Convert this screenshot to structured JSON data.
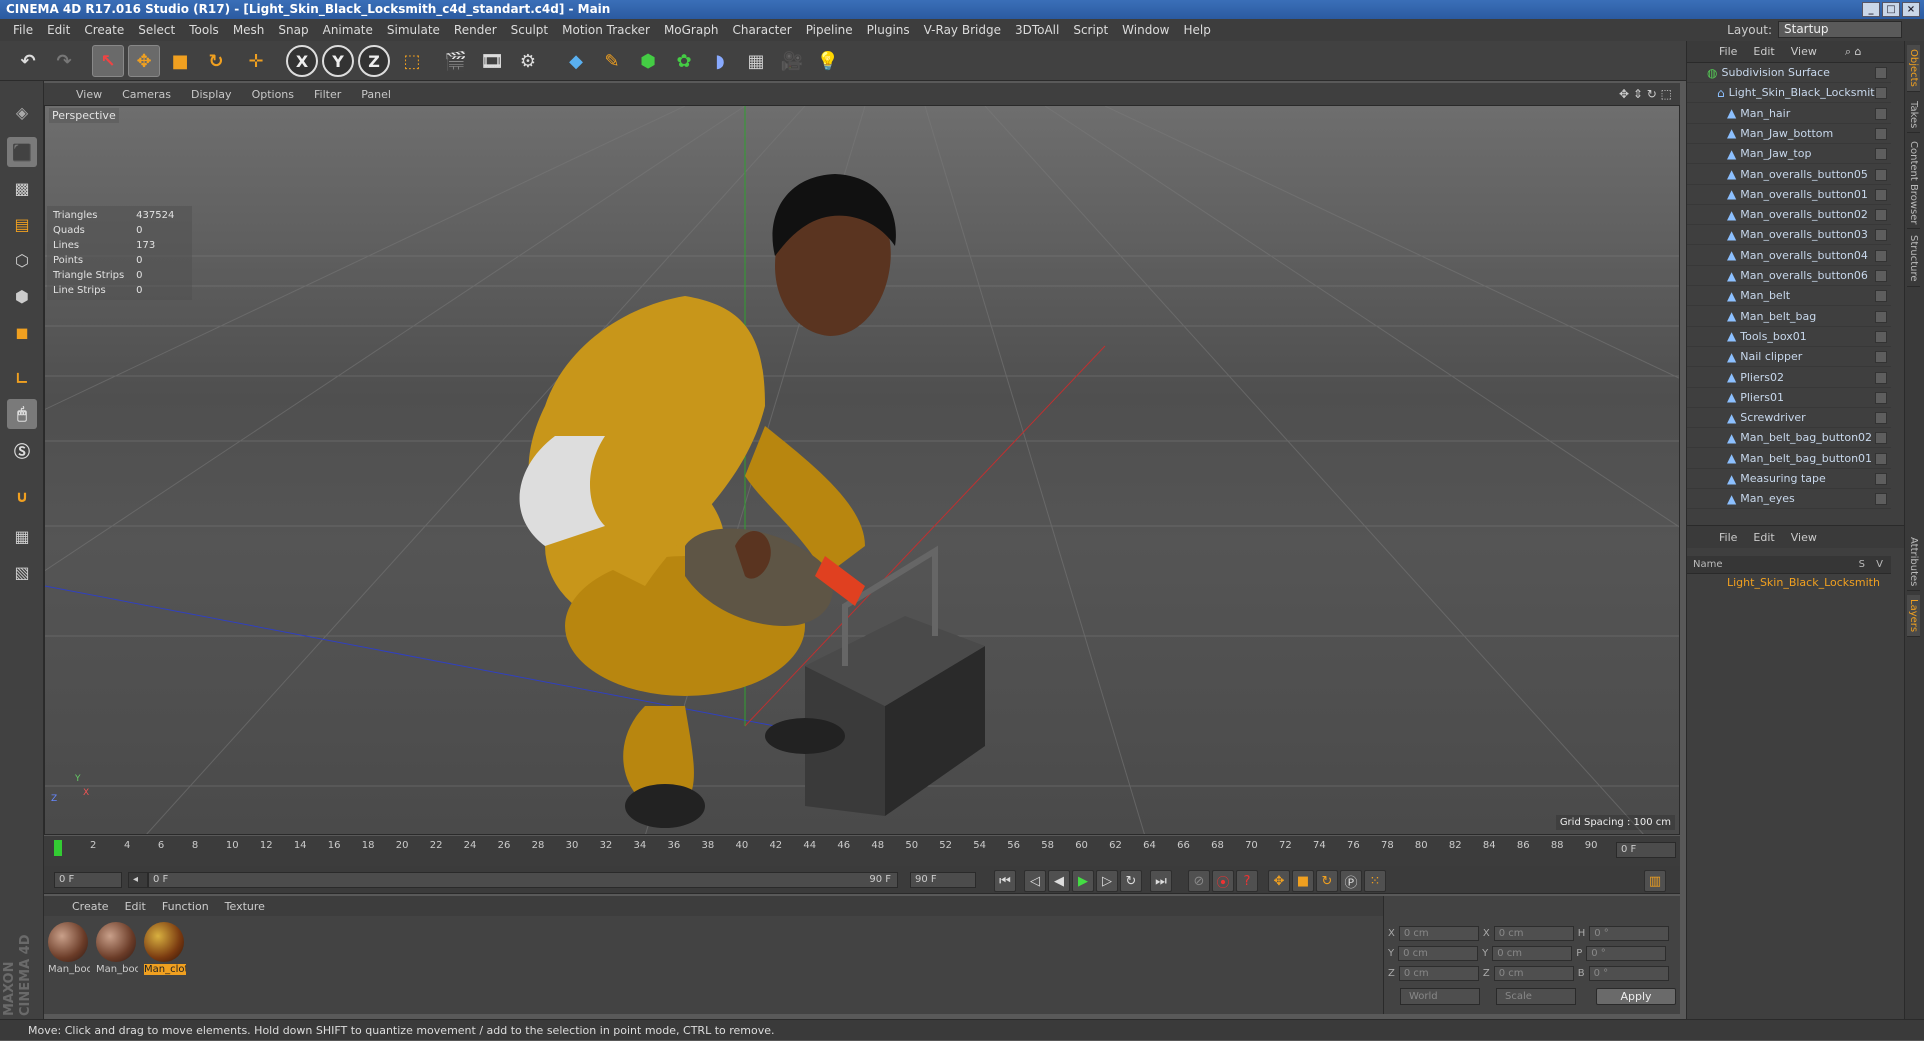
{
  "window": {
    "title": "CINEMA 4D R17.016 Studio (R17) - [Light_Skin_Black_Locksmith_c4d_standart.c4d] - Main"
  },
  "menu": [
    "File",
    "Edit",
    "Create",
    "Select",
    "Tools",
    "Mesh",
    "Snap",
    "Animate",
    "Simulate",
    "Render",
    "Sculpt",
    "Motion Tracker",
    "MoGraph",
    "Character",
    "Pipeline",
    "Plugins",
    "V-Ray Bridge",
    "3DToAll",
    "Script",
    "Window",
    "Help"
  ],
  "layout": {
    "label": "Layout:",
    "value": "Startup"
  },
  "toolbar": {
    "x": "X",
    "y": "Y",
    "z": "Z"
  },
  "viewport": {
    "menu": [
      "View",
      "Cameras",
      "Display",
      "Options",
      "Filter",
      "Panel"
    ],
    "label": "Perspective",
    "stats": [
      {
        "k": "Triangles",
        "v": "437524"
      },
      {
        "k": "Quads",
        "v": "0"
      },
      {
        "k": "Lines",
        "v": "173"
      },
      {
        "k": "Points",
        "v": "0"
      },
      {
        "k": "Triangle Strips",
        "v": "0"
      },
      {
        "k": "Line Strips",
        "v": "0"
      }
    ],
    "grid_spacing": "Grid Spacing : 100 cm",
    "axis_y": "Y",
    "axis_z": "Z",
    "axis_x": "X"
  },
  "timeline": {
    "ticks": [
      "0",
      "2",
      "4",
      "6",
      "8",
      "10",
      "12",
      "14",
      "16",
      "18",
      "20",
      "22",
      "24",
      "26",
      "28",
      "30",
      "32",
      "34",
      "36",
      "38",
      "40",
      "42",
      "44",
      "46",
      "48",
      "50",
      "52",
      "54",
      "56",
      "58",
      "60",
      "62",
      "64",
      "66",
      "68",
      "70",
      "72",
      "74",
      "76",
      "78",
      "80",
      "82",
      "84",
      "86",
      "88",
      "90"
    ],
    "current_frame": "0 F",
    "start": "0 F",
    "range_start": "0 F",
    "range_end": "90 F",
    "end": "90 F"
  },
  "materials": {
    "menu": [
      "Create",
      "Edit",
      "Function",
      "Texture"
    ],
    "items": [
      {
        "label": "Man_boc"
      },
      {
        "label": "Man_boc"
      },
      {
        "label": "Man_clot"
      }
    ]
  },
  "coords": {
    "rows": [
      {
        "a": "X",
        "av": "0 cm",
        "b": "X",
        "bv": "0 cm",
        "c": "H",
        "cv": "0 °"
      },
      {
        "a": "Y",
        "av": "0 cm",
        "b": "Y",
        "bv": "0 cm",
        "c": "P",
        "cv": "0 °"
      },
      {
        "a": "Z",
        "av": "0 cm",
        "b": "Z",
        "bv": "0 cm",
        "c": "B",
        "cv": "0 °"
      }
    ],
    "world": "World",
    "scale": "Scale",
    "apply": "Apply"
  },
  "status": "Move: Click and drag to move elements. Hold down SHIFT to quantize movement / add to the selection in point mode, CTRL to remove.",
  "objects": {
    "menu": [
      "File",
      "Edit",
      "View"
    ],
    "items": [
      "Subdivision Surface",
      "Light_Skin_Black_Locksmith",
      "Man_hair",
      "Man_Jaw_bottom",
      "Man_Jaw_top",
      "Man_overalls_button05",
      "Man_overalls_button01",
      "Man_overalls_button02",
      "Man_overalls_button03",
      "Man_overalls_button04",
      "Man_overalls_button06",
      "Man_belt",
      "Man_belt_bag",
      "Tools_box01",
      "Nail clipper",
      "Pliers02",
      "Pliers01",
      "Screwdriver",
      "Man_belt_bag_button02",
      "Man_belt_bag_button01",
      "Measuring tape",
      "Man_eyes"
    ]
  },
  "layers": {
    "menu": [
      "File",
      "Edit",
      "View"
    ],
    "col_name": "Name",
    "col_s": "S",
    "col_v": "V",
    "item": "Light_Skin_Black_Locksmith"
  },
  "sidetabs": [
    "Objects",
    "Takes",
    "Content Browser",
    "Structure",
    "Attributes",
    "Layers"
  ],
  "brand": "MAXON CINEMA 4D"
}
